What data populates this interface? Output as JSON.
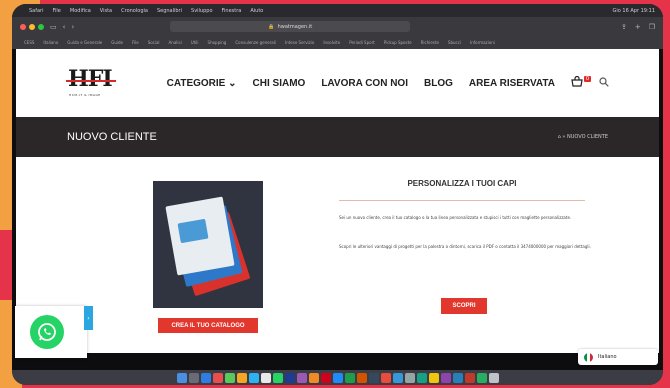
{
  "menubar": {
    "items": [
      "Safari",
      "File",
      "Modifica",
      "Vista",
      "Cronologia",
      "Segnalibri",
      "Sviluppo",
      "Finestra",
      "Aiuto"
    ],
    "right": [
      "Gio 16 Apr 19:11"
    ]
  },
  "browser": {
    "url": "hwatmagen.it",
    "bookmarks": [
      "CESS",
      "Italiano",
      "Guida e Generale",
      "Guide",
      "File",
      "Social",
      "Analisi",
      "Utili",
      "Shopping",
      "Consulenze generali",
      "Intese Servizio",
      "Insolvite",
      "Periodi Sport",
      "Pickup Sposte",
      "Richieste",
      "Sbucci",
      "Informazioni"
    ]
  },
  "header": {
    "logo_text": "HFI",
    "logo_subtext": "HCM-IT & IMAGE",
    "nav": [
      "CATEGORIE",
      "CHI SIAMO",
      "LAVORA CON NOI",
      "BLOG",
      "AREA RISERVATA"
    ],
    "cart_count": "0"
  },
  "banner": {
    "title": "NUOVO CLIENTE",
    "breadcrumb": "⌂ » NUOVO CLIENTE"
  },
  "content": {
    "catalog_button": "CREA IL TUO CATALOGO",
    "heading": "PERSONALIZZA I TUOI CAPI",
    "paragraph1": "Sei un nuovo cliente, crea il tuo catalogo o la tua linea personalizzata e stupisci i tutti con magliette personalizzate.",
    "paragraph2": "Scopri le ulteriori vantaggi di progetti per la palestra o dintorni, scarica il PDF o contatta il 3474000000 per maggiori dettagli.",
    "scopri_button": "SCOPRI"
  },
  "language": {
    "label": "Italiano"
  },
  "colors": {
    "accent_red": "#e2372d",
    "banner_dark": "#2b2628",
    "whatsapp_green": "#25d366"
  }
}
